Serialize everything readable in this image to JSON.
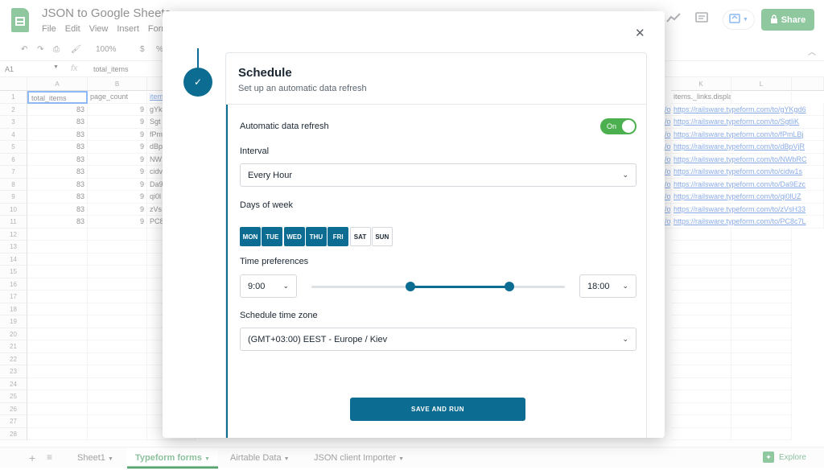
{
  "app": {
    "title": "JSON to Google Sheets",
    "menus": [
      "File",
      "Edit",
      "View",
      "Insert",
      "Form"
    ],
    "share_label": "Share",
    "zoom": "100%",
    "currency": "$",
    "percent": "%"
  },
  "formula_bar": {
    "cell_ref": "A1",
    "fx": "fx",
    "value": "total_items"
  },
  "grid": {
    "left_columns": [
      "A",
      "B"
    ],
    "right_columns": [
      "K",
      "L"
    ],
    "header_row": {
      "A": "total_items",
      "B": "page_count",
      "C": "item",
      "K": "items._links.display"
    },
    "a_values": [
      "83",
      "83",
      "83",
      "83",
      "83",
      "83",
      "83",
      "83",
      "83",
      "83"
    ],
    "b_values": [
      "9",
      "9",
      "9",
      "9",
      "9",
      "9",
      "9",
      "9",
      "9",
      "9"
    ],
    "c_values": [
      "gYk",
      "Sgt",
      "fPm",
      "dBp",
      "NW",
      "cidv",
      "Da9",
      "qi0l",
      "zVs",
      "PC8"
    ],
    "k_values": [
      "https://railsware.typeform.com/to/gYKgd6",
      "https://railsware.typeform.com/to/SgtliK",
      "https://railsware.typeform.com/to/fPmLBj",
      "https://railsware.typeform.com/to/dBpVjR",
      "https://railsware.typeform.com/to/NWbRC",
      "https://railsware.typeform.com/to/cidw1s",
      "https://railsware.typeform.com/to/Da9Ezc",
      "https://railsware.typeform.com/to/qi0lUZ",
      "https://railsware.typeform.com/to/zVsH33",
      "https://railsware.typeform.com/to/PC8c7L"
    ],
    "j_partial": [
      "/o",
      "/o",
      "/o",
      "/o",
      "/o",
      "/o",
      "/o",
      "/o",
      "/o",
      "/o"
    ],
    "row_numbers": [
      "1",
      "2",
      "3",
      "4",
      "5",
      "6",
      "7",
      "8",
      "9",
      "10",
      "11",
      "12",
      "13",
      "14",
      "15",
      "16",
      "17",
      "18",
      "19",
      "20",
      "21",
      "22",
      "23",
      "24",
      "25",
      "26",
      "27",
      "28"
    ]
  },
  "sheets": {
    "tabs": [
      "Sheet1",
      "Typeform forms",
      "Airtable Data",
      "JSON client Importer"
    ],
    "active": "Typeform forms",
    "explore_label": "Explore"
  },
  "modal": {
    "title": "Schedule",
    "subtitle": "Set up an automatic data refresh",
    "auto_refresh_label": "Automatic data refresh",
    "toggle_state": "On",
    "interval_label": "Interval",
    "interval_value": "Every Hour",
    "days_label": "Days of week",
    "days": [
      {
        "label": "MON",
        "selected": true
      },
      {
        "label": "TUE",
        "selected": true
      },
      {
        "label": "WED",
        "selected": true
      },
      {
        "label": "THU",
        "selected": true
      },
      {
        "label": "FRI",
        "selected": true
      },
      {
        "label": "SAT",
        "selected": false
      },
      {
        "label": "SUN",
        "selected": false
      }
    ],
    "time_label": "Time preferences",
    "time_from": "9:00",
    "time_to": "18:00",
    "slider_range": {
      "start_fraction": 0.39,
      "end_fraction": 0.78
    },
    "tz_label": "Schedule time zone",
    "tz_value": "(GMT+03:00) EEST - Europe / Kiev",
    "save_label": "SAVE AND RUN"
  },
  "colors": {
    "accent": "#0d6c91",
    "sheets_green": "#1e8e3e",
    "toggle_green": "#4caf50"
  }
}
